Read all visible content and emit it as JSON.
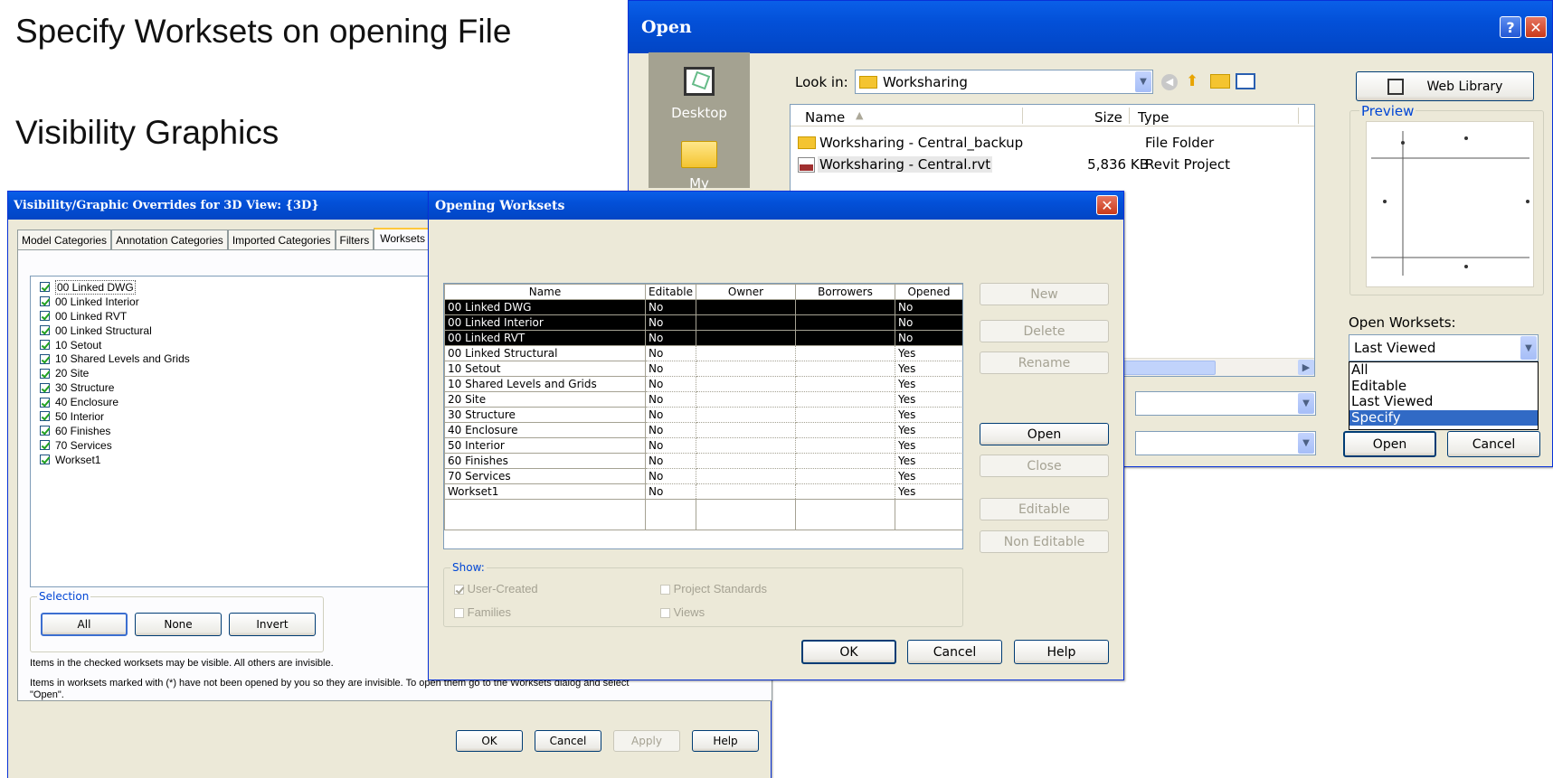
{
  "slide": {
    "line1": "Specify Worksets on opening File",
    "line2": "Visibility Graphics"
  },
  "open_dialog": {
    "title": "Open",
    "places": [
      "Desktop",
      "My Documents"
    ],
    "look_in_label": "Look in:",
    "look_in_value": "Worksharing",
    "web_library": "Web Library",
    "columns": {
      "name": "Name",
      "size": "Size",
      "type": "Type"
    },
    "files": [
      {
        "name": "Worksharing - Central_backup",
        "size": "",
        "type": "File Folder",
        "icon": "folder-icon"
      },
      {
        "name": "Worksharing - Central.rvt",
        "size": "5,836 KB",
        "type": "Revit Project",
        "icon": "revit-file-icon"
      }
    ],
    "preview_label": "Preview",
    "open_worksets_label": "Open Worksets:",
    "open_worksets_value": "Last Viewed",
    "open_worksets_options": [
      "All",
      "Editable",
      "Last Viewed",
      "Specify"
    ],
    "selected_option": "Specify",
    "open_button": "Open",
    "cancel_button": "Cancel"
  },
  "vg_dialog": {
    "title": "Visibility/Graphic Overrides for 3D View: {3D}",
    "tabs": [
      "Model Categories",
      "Annotation Categories",
      "Imported Categories",
      "Filters",
      "Worksets"
    ],
    "active_tab": "Worksets",
    "worksets": [
      "00 Linked DWG",
      "00 Linked Interior",
      "00 Linked RVT",
      "00 Linked Structural",
      "10 Setout",
      "10 Shared Levels and Grids",
      "20 Site",
      "30 Structure",
      "40 Enclosure",
      "50 Interior",
      "60 Finishes",
      "70 Services",
      "Workset1"
    ],
    "selection_label": "Selection",
    "buttons": {
      "all": "All",
      "none": "None",
      "invert": "Invert"
    },
    "note1": "Items in the checked worksets may be visible.  All others are invisible.",
    "note2": "Items in worksets marked with (*) have not been opened by you so they are invisible.  To open them go to the Worksets dialog and select \"Open\".",
    "footer": {
      "ok": "OK",
      "cancel": "Cancel",
      "apply": "Apply",
      "help": "Help"
    }
  },
  "ow_dialog": {
    "title": "Opening Worksets",
    "columns": [
      "Name",
      "Editable",
      "Owner",
      "Borrowers",
      "Opened"
    ],
    "rows": [
      {
        "name": "00 Linked DWG",
        "editable": "No",
        "owner": "",
        "borrowers": "",
        "opened": "No",
        "selected": true
      },
      {
        "name": "00 Linked Interior",
        "editable": "No",
        "owner": "",
        "borrowers": "",
        "opened": "No",
        "selected": true
      },
      {
        "name": "00 Linked RVT",
        "editable": "No",
        "owner": "",
        "borrowers": "",
        "opened": "No",
        "selected": true
      },
      {
        "name": "00 Linked Structural",
        "editable": "No",
        "owner": "",
        "borrowers": "",
        "opened": "Yes",
        "selected": false
      },
      {
        "name": "10 Setout",
        "editable": "No",
        "owner": "",
        "borrowers": "",
        "opened": "Yes",
        "selected": false
      },
      {
        "name": "10 Shared Levels and Grids",
        "editable": "No",
        "owner": "",
        "borrowers": "",
        "opened": "Yes",
        "selected": false
      },
      {
        "name": "20 Site",
        "editable": "No",
        "owner": "",
        "borrowers": "",
        "opened": "Yes",
        "selected": false
      },
      {
        "name": "30 Structure",
        "editable": "No",
        "owner": "",
        "borrowers": "",
        "opened": "Yes",
        "selected": false
      },
      {
        "name": "40 Enclosure",
        "editable": "No",
        "owner": "",
        "borrowers": "",
        "opened": "Yes",
        "selected": false
      },
      {
        "name": "50 Interior",
        "editable": "No",
        "owner": "",
        "borrowers": "",
        "opened": "Yes",
        "selected": false
      },
      {
        "name": "60 Finishes",
        "editable": "No",
        "owner": "",
        "borrowers": "",
        "opened": "Yes",
        "selected": false
      },
      {
        "name": "70 Services",
        "editable": "No",
        "owner": "",
        "borrowers": "",
        "opened": "Yes",
        "selected": false
      },
      {
        "name": "Workset1",
        "editable": "No",
        "owner": "",
        "borrowers": "",
        "opened": "Yes",
        "selected": false
      }
    ],
    "side_buttons": {
      "new": "New",
      "delete": "Delete",
      "rename": "Rename",
      "open": "Open",
      "close": "Close",
      "editable": "Editable",
      "non_editable": "Non Editable"
    },
    "show_label": "Show:",
    "show": {
      "user_created": "User-Created",
      "project_standards": "Project Standards",
      "families": "Families",
      "views": "Views"
    },
    "footer": {
      "ok": "OK",
      "cancel": "Cancel",
      "help": "Help"
    }
  },
  "colors": {
    "title_bar": "#0350d8",
    "dialog_bg": "#ece9d8",
    "selection": "#316ac5"
  }
}
